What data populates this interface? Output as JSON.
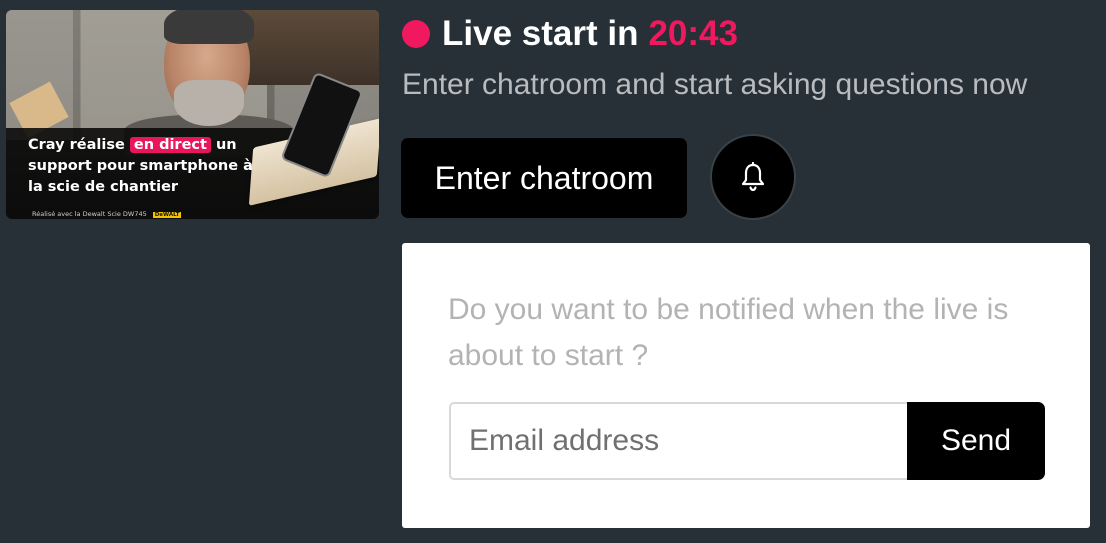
{
  "thumbnail": {
    "caption_part1": "Cray réalise ",
    "caption_highlight": "en direct",
    "caption_part2": " un support pour smartphone à la scie de chantier",
    "small_text": "Réalisé avec la Dewalt Scie DW745",
    "brand_logo": "DeWALT"
  },
  "live": {
    "label": "Live start in",
    "countdown": "20:43",
    "accent_color": "#f0185e"
  },
  "subtitle": "Enter chatroom and start asking questions now",
  "enter_button": {
    "label": "Enter chatroom"
  },
  "bell_button": {
    "icon": "bell-icon"
  },
  "notify": {
    "question": "Do you want to be notified when the live is about to start ?",
    "email_placeholder": "Email address",
    "email_value": "",
    "send_label": "Send"
  },
  "colors": {
    "background": "#273037",
    "button": "#000000",
    "card": "#ffffff"
  }
}
